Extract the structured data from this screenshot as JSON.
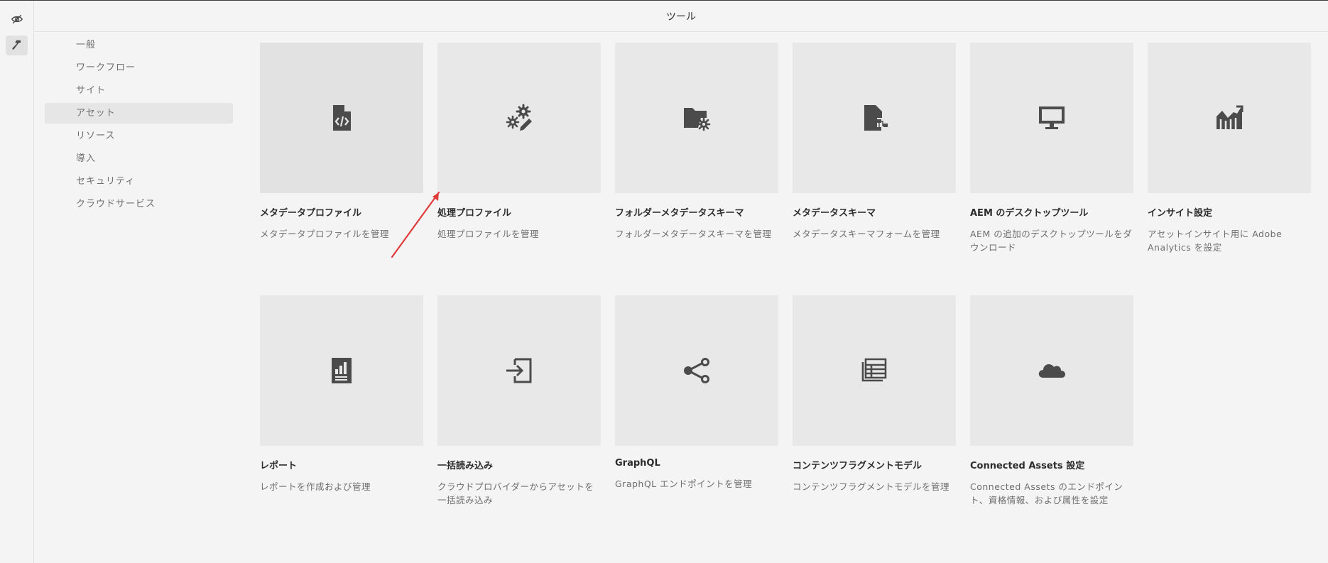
{
  "header": {
    "title": "ツール"
  },
  "rail": {
    "items": [
      {
        "icon": "eye-off-icon"
      },
      {
        "icon": "hammer-icon",
        "selected": true
      }
    ]
  },
  "sidenav": {
    "items": [
      {
        "label": "一般"
      },
      {
        "label": "ワークフロー"
      },
      {
        "label": "サイト"
      },
      {
        "label": "アセット",
        "active": true
      },
      {
        "label": "リソース"
      },
      {
        "label": "導入"
      },
      {
        "label": "セキュリティ"
      },
      {
        "label": "クラウドサービス"
      }
    ]
  },
  "cards": [
    {
      "title": "メタデータプロファイル",
      "desc": "メタデータプロファイルを管理",
      "icon": "file-code-icon",
      "selected": true
    },
    {
      "title": "処理プロファイル",
      "desc": "処理プロファイルを管理",
      "icon": "gears-edit-icon"
    },
    {
      "title": "フォルダーメタデータスキーマ",
      "desc": "フォルダーメタデータスキーマを管理",
      "icon": "folder-gear-icon"
    },
    {
      "title": "メタデータスキーマ",
      "desc": "メタデータスキーマフォームを管理",
      "icon": "file-schema-icon"
    },
    {
      "title": "AEM のデスクトップツール",
      "desc": "AEM の追加のデスクトップツールをダウンロード",
      "icon": "monitor-icon"
    },
    {
      "title": "インサイト設定",
      "desc": "アセットインサイト用に Adobe Analytics を設定",
      "icon": "chart-trend-icon"
    },
    {
      "title": "レポート",
      "desc": "レポートを作成および管理",
      "icon": "report-icon"
    },
    {
      "title": "一括読み込み",
      "desc": "クラウドプロバイダーからアセットを一括読み込み",
      "icon": "import-icon"
    },
    {
      "title": "GraphQL",
      "desc": "GraphQL エンドポイントを管理",
      "icon": "share-icon"
    },
    {
      "title": "コンテンツフラグメントモデル",
      "desc": "コンテンツフラグメントモデルを管理",
      "icon": "fragments-icon"
    },
    {
      "title": "Connected Assets 設定",
      "desc": "Connected Assets のエンドポイント、資格情報、および属性を設定",
      "icon": "cloud-icon"
    }
  ],
  "colors": {
    "annotation_arrow": "#e03a3a"
  }
}
